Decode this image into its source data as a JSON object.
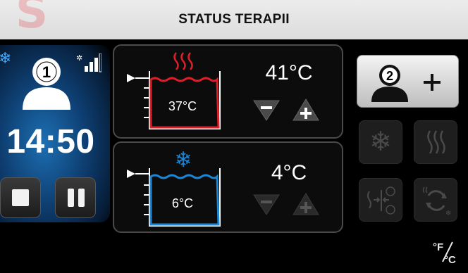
{
  "header": {
    "title": "STATUS TERAPII",
    "logo_letter": "S"
  },
  "patient1": {
    "number": "1",
    "time": "14:50",
    "icons": [
      "snowflake-icon",
      "person-icon",
      "signal-icon",
      "stop-icon",
      "pause-icon"
    ]
  },
  "hot_channel": {
    "current_temp": "37°C",
    "set_temp": "41°C",
    "icons": [
      "heat-waves-icon",
      "minus-icon",
      "plus-icon"
    ]
  },
  "cold_channel": {
    "current_temp": "6°C",
    "set_temp": "4°C",
    "icons": [
      "snowflake-icon",
      "minus-icon",
      "plus-icon"
    ]
  },
  "patient2": {
    "number": "2",
    "icons": [
      "person-icon",
      "plus-icon"
    ]
  },
  "mode_buttons": [
    "snowflake-icon",
    "heat-waves-icon",
    "contrast-icon",
    "cycle-icon"
  ],
  "unit_toggle": {
    "icon": "fahrenheit-celsius-icon"
  },
  "colors": {
    "hot": "#e01e28",
    "cold": "#1b87d6",
    "header_bg": "#e3e3e3",
    "background": "#000000"
  }
}
